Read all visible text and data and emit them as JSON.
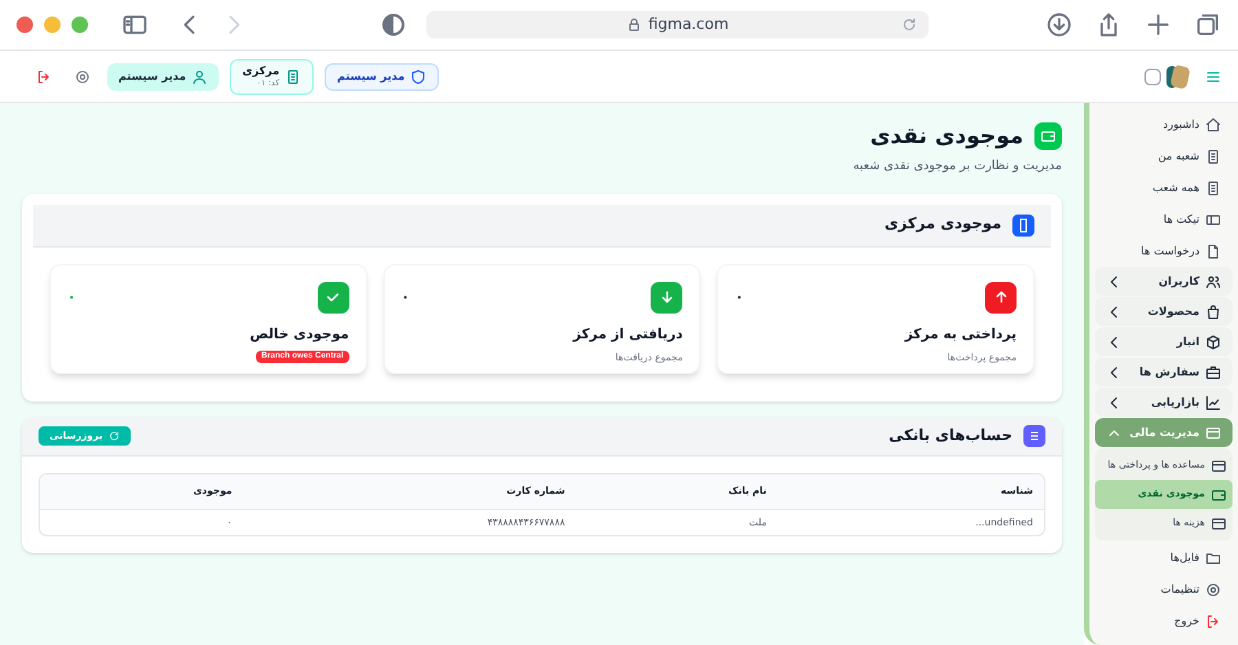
{
  "browser": {
    "url": "figma.com"
  },
  "header": {
    "chips": [
      {
        "kind": "role",
        "label": "مدیر سیستم"
      },
      {
        "kind": "branch",
        "label": "مرکزی",
        "sub": "کد: ۰۱"
      },
      {
        "kind": "user",
        "label": "مدیر سیستم"
      }
    ]
  },
  "page": {
    "title": "موجودی نقدی",
    "subtitle": "مدیریت و نظارت بر موجودی نقدی شعبه"
  },
  "central": {
    "title": "موجودی مرکزی",
    "stats": [
      {
        "kind": "up",
        "color": "#ef1c24",
        "title": "پرداختی به مرکز",
        "subtitle": "مجموع پرداخت‌ها",
        "value": "۰"
      },
      {
        "kind": "down",
        "color": "#16b34a",
        "title": "دریافتی از مرکز",
        "subtitle": "مجموع دریافت‌ها",
        "value": "۰"
      },
      {
        "kind": "check",
        "color": "#16b34a",
        "title": "موجودی خالص",
        "badge": "Branch owes Central",
        "value": "۰"
      }
    ]
  },
  "bank": {
    "title": "حساب‌های بانکی",
    "refresh": "بروزرسانی",
    "columns": [
      "شناسه",
      "نام بانک",
      "شماره کارت",
      "موجودی"
    ],
    "rows": [
      [
        "undefined...",
        "ملت",
        "۴۳۸۸۸۸۴۳۶۶۷۷۸۸۸",
        "۰"
      ]
    ]
  },
  "sidebar": {
    "items": [
      {
        "kind": "link",
        "label": "داشبورد"
      },
      {
        "kind": "link",
        "label": "شعبه من"
      },
      {
        "kind": "link",
        "label": "همه شعب"
      },
      {
        "kind": "link",
        "label": "تیکت ها"
      },
      {
        "kind": "link",
        "label": "درخواست ها"
      },
      {
        "kind": "group",
        "label": "کاربران",
        "expanded": false
      },
      {
        "kind": "group",
        "label": "محصولات",
        "expanded": false
      },
      {
        "kind": "group",
        "label": "انبار",
        "expanded": false
      },
      {
        "kind": "group",
        "label": "سفارش ها",
        "expanded": false
      },
      {
        "kind": "group",
        "label": "بازاریابی",
        "expanded": false
      },
      {
        "kind": "group",
        "label": "مدیریت مالی",
        "expanded": true,
        "children": [
          {
            "label": "مساعده ها و پرداختی ها",
            "selected": false
          },
          {
            "label": "موجودی نقدی",
            "selected": true
          },
          {
            "label": "هزینه ها",
            "selected": false
          }
        ]
      },
      {
        "kind": "link",
        "label": "فایل‌ها"
      },
      {
        "kind": "link",
        "label": "تنظیمات"
      },
      {
        "kind": "logout",
        "label": "خروج"
      }
    ]
  }
}
